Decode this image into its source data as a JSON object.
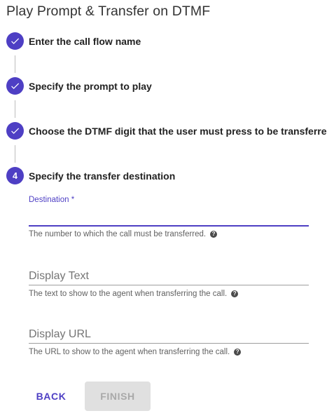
{
  "page": {
    "title": "Play Prompt & Transfer on DTMF"
  },
  "steps": [
    {
      "label": "Enter the call flow name",
      "state": "completed",
      "icon": "check-icon"
    },
    {
      "label": "Specify the prompt to play",
      "state": "completed",
      "icon": "check-icon"
    },
    {
      "label": "Choose the DTMF digit that the user must press to be transferred",
      "state": "completed",
      "icon": "check-icon"
    },
    {
      "label": "Specify the transfer destination",
      "state": "active",
      "number": "4"
    }
  ],
  "form": {
    "destination": {
      "label": "Destination *",
      "value": "",
      "helper": "The number to which the call must be transferred.",
      "help_icon": "?"
    },
    "display_text": {
      "placeholder": "Display Text",
      "value": "",
      "helper": "The text to show to the agent when transferring the call.",
      "help_icon": "?"
    },
    "display_url": {
      "placeholder": "Display URL",
      "value": "",
      "helper": "The URL to show to the agent when transferring the call.",
      "help_icon": "?"
    }
  },
  "actions": {
    "back_label": "BACK",
    "finish_label": "FINISH",
    "finish_disabled": true
  },
  "colors": {
    "primary": "#4e3fc4",
    "disabled_bg": "#e0e0e0",
    "disabled_text": "#a9a9a9",
    "divider": "#9e9e9e"
  }
}
